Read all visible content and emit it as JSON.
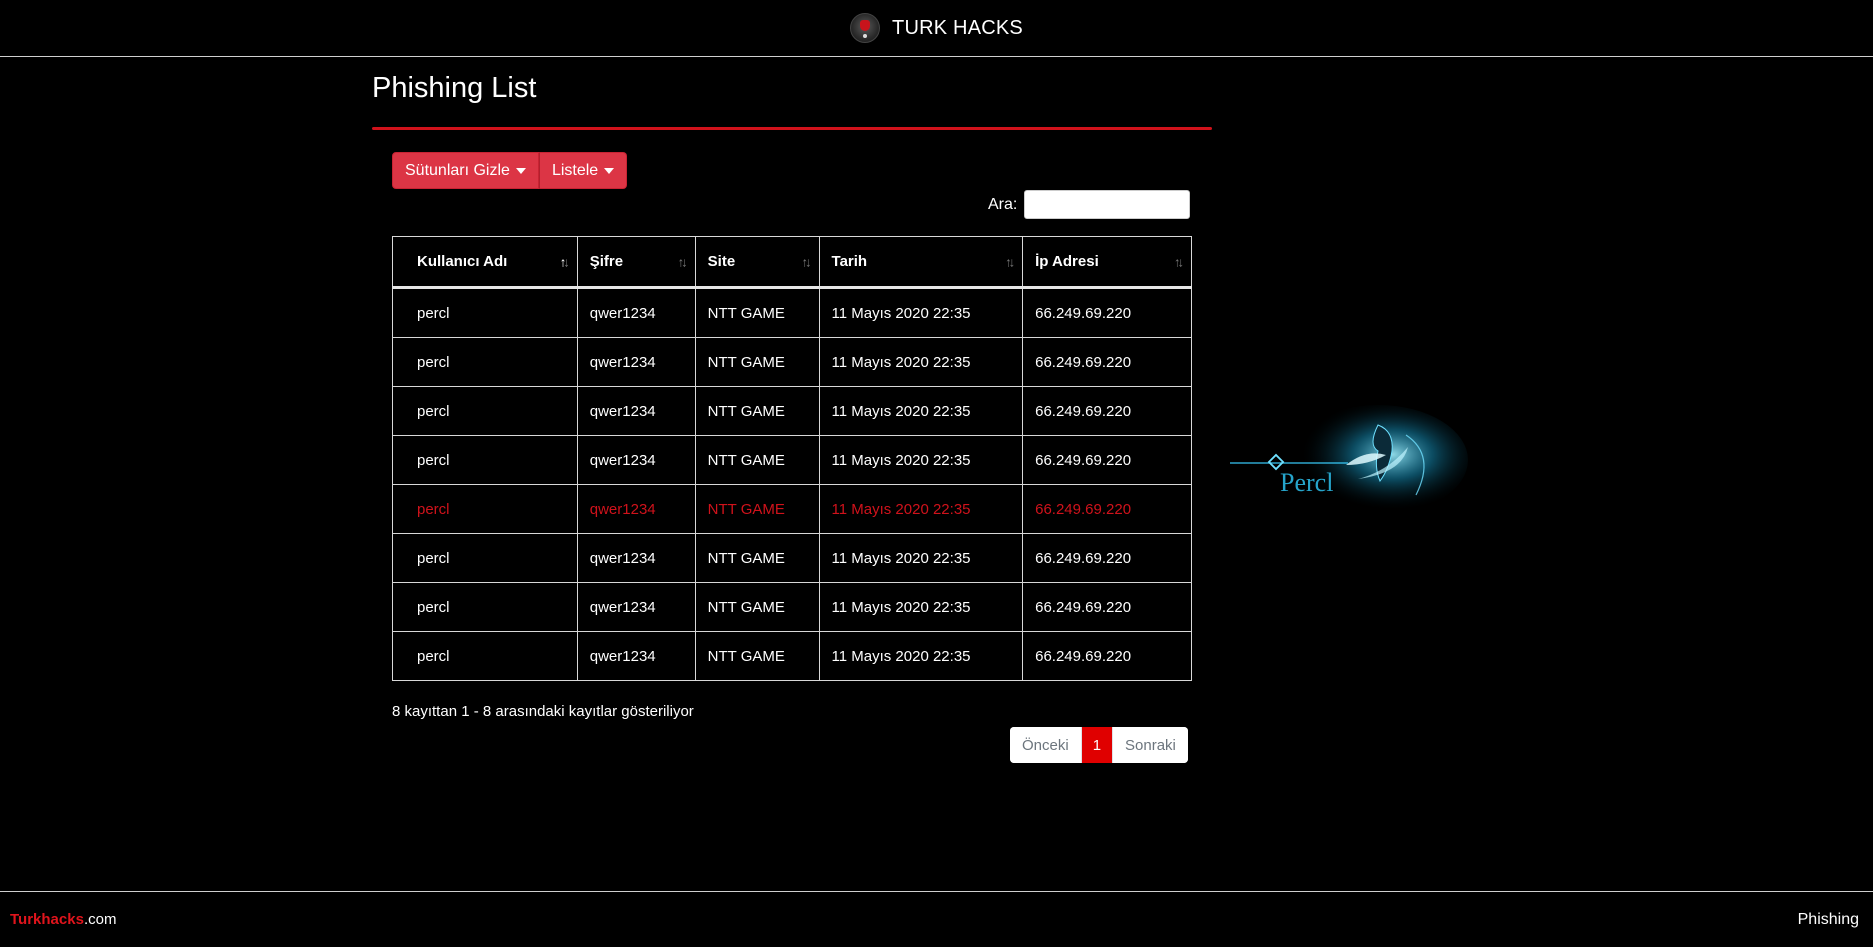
{
  "header": {
    "brand": "TURK HACKS",
    "logo_icon": "turkhacks-logo-icon"
  },
  "page": {
    "title": "Phishing List"
  },
  "toolbar": {
    "hide_columns_label": "Sütunları Gizle",
    "list_label": "Listele",
    "search_label": "Ara:",
    "search_value": ""
  },
  "table": {
    "columns": [
      "Kullanıcı Adı",
      "Şifre",
      "Site",
      "Tarih",
      "İp Adresi"
    ],
    "sorted_column": 0,
    "rows": [
      [
        "percl",
        "qwer1234",
        "NTT GAME",
        "11 Mayıs 2020 22:35",
        "66.249.69.220"
      ],
      [
        "percl",
        "qwer1234",
        "NTT GAME",
        "11 Mayıs 2020 22:35",
        "66.249.69.220"
      ],
      [
        "percl",
        "qwer1234",
        "NTT GAME",
        "11 Mayıs 2020 22:35",
        "66.249.69.220"
      ],
      [
        "percl",
        "qwer1234",
        "NTT GAME",
        "11 Mayıs 2020 22:35",
        "66.249.69.220"
      ],
      [
        "percl",
        "qwer1234",
        "NTT GAME",
        "11 Mayıs 2020 22:35",
        "66.249.69.220"
      ],
      [
        "percl",
        "qwer1234",
        "NTT GAME",
        "11 Mayıs 2020 22:35",
        "66.249.69.220"
      ],
      [
        "percl",
        "qwer1234",
        "NTT GAME",
        "11 Mayıs 2020 22:35",
        "66.249.69.220"
      ],
      [
        "percl",
        "qwer1234",
        "NTT GAME",
        "11 Mayıs 2020 22:35",
        "66.249.69.220"
      ]
    ],
    "highlighted_row": 4,
    "highlight_color": "#d0121b"
  },
  "info": {
    "text": "8 kayıttan 1 - 8 arasındaki kayıtlar gösteriliyor"
  },
  "pagination": {
    "prev": "Önceki",
    "current": "1",
    "next": "Sonraki"
  },
  "emblem": {
    "text": "Percl",
    "icon": "bird-emblem-icon"
  },
  "footer": {
    "brand_red": "Turkhacks",
    "brand_suffix": ".com",
    "right_text": "Phishing"
  },
  "colors": {
    "accent": "#d0121b",
    "button": "#dc3545",
    "active_page": "#e00000",
    "emblem": "#38d0ff"
  }
}
